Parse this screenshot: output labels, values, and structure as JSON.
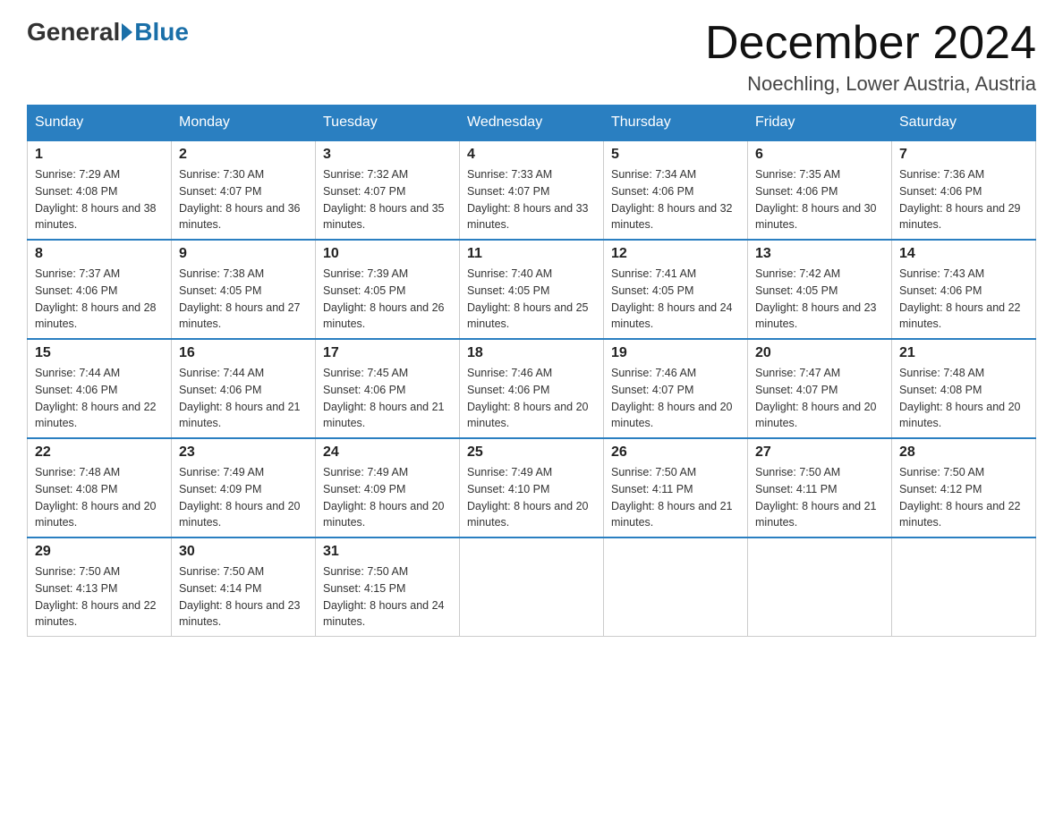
{
  "header": {
    "logo_general": "General",
    "logo_blue": "Blue",
    "month_title": "December 2024",
    "location": "Noechling, Lower Austria, Austria"
  },
  "days_of_week": [
    "Sunday",
    "Monday",
    "Tuesday",
    "Wednesday",
    "Thursday",
    "Friday",
    "Saturday"
  ],
  "weeks": [
    [
      {
        "day": "1",
        "sunrise": "7:29 AM",
        "sunset": "4:08 PM",
        "daylight": "8 hours and 38 minutes."
      },
      {
        "day": "2",
        "sunrise": "7:30 AM",
        "sunset": "4:07 PM",
        "daylight": "8 hours and 36 minutes."
      },
      {
        "day": "3",
        "sunrise": "7:32 AM",
        "sunset": "4:07 PM",
        "daylight": "8 hours and 35 minutes."
      },
      {
        "day": "4",
        "sunrise": "7:33 AM",
        "sunset": "4:07 PM",
        "daylight": "8 hours and 33 minutes."
      },
      {
        "day": "5",
        "sunrise": "7:34 AM",
        "sunset": "4:06 PM",
        "daylight": "8 hours and 32 minutes."
      },
      {
        "day": "6",
        "sunrise": "7:35 AM",
        "sunset": "4:06 PM",
        "daylight": "8 hours and 30 minutes."
      },
      {
        "day": "7",
        "sunrise": "7:36 AM",
        "sunset": "4:06 PM",
        "daylight": "8 hours and 29 minutes."
      }
    ],
    [
      {
        "day": "8",
        "sunrise": "7:37 AM",
        "sunset": "4:06 PM",
        "daylight": "8 hours and 28 minutes."
      },
      {
        "day": "9",
        "sunrise": "7:38 AM",
        "sunset": "4:05 PM",
        "daylight": "8 hours and 27 minutes."
      },
      {
        "day": "10",
        "sunrise": "7:39 AM",
        "sunset": "4:05 PM",
        "daylight": "8 hours and 26 minutes."
      },
      {
        "day": "11",
        "sunrise": "7:40 AM",
        "sunset": "4:05 PM",
        "daylight": "8 hours and 25 minutes."
      },
      {
        "day": "12",
        "sunrise": "7:41 AM",
        "sunset": "4:05 PM",
        "daylight": "8 hours and 24 minutes."
      },
      {
        "day": "13",
        "sunrise": "7:42 AM",
        "sunset": "4:05 PM",
        "daylight": "8 hours and 23 minutes."
      },
      {
        "day": "14",
        "sunrise": "7:43 AM",
        "sunset": "4:06 PM",
        "daylight": "8 hours and 22 minutes."
      }
    ],
    [
      {
        "day": "15",
        "sunrise": "7:44 AM",
        "sunset": "4:06 PM",
        "daylight": "8 hours and 22 minutes."
      },
      {
        "day": "16",
        "sunrise": "7:44 AM",
        "sunset": "4:06 PM",
        "daylight": "8 hours and 21 minutes."
      },
      {
        "day": "17",
        "sunrise": "7:45 AM",
        "sunset": "4:06 PM",
        "daylight": "8 hours and 21 minutes."
      },
      {
        "day": "18",
        "sunrise": "7:46 AM",
        "sunset": "4:06 PM",
        "daylight": "8 hours and 20 minutes."
      },
      {
        "day": "19",
        "sunrise": "7:46 AM",
        "sunset": "4:07 PM",
        "daylight": "8 hours and 20 minutes."
      },
      {
        "day": "20",
        "sunrise": "7:47 AM",
        "sunset": "4:07 PM",
        "daylight": "8 hours and 20 minutes."
      },
      {
        "day": "21",
        "sunrise": "7:48 AM",
        "sunset": "4:08 PM",
        "daylight": "8 hours and 20 minutes."
      }
    ],
    [
      {
        "day": "22",
        "sunrise": "7:48 AM",
        "sunset": "4:08 PM",
        "daylight": "8 hours and 20 minutes."
      },
      {
        "day": "23",
        "sunrise": "7:49 AM",
        "sunset": "4:09 PM",
        "daylight": "8 hours and 20 minutes."
      },
      {
        "day": "24",
        "sunrise": "7:49 AM",
        "sunset": "4:09 PM",
        "daylight": "8 hours and 20 minutes."
      },
      {
        "day": "25",
        "sunrise": "7:49 AM",
        "sunset": "4:10 PM",
        "daylight": "8 hours and 20 minutes."
      },
      {
        "day": "26",
        "sunrise": "7:50 AM",
        "sunset": "4:11 PM",
        "daylight": "8 hours and 21 minutes."
      },
      {
        "day": "27",
        "sunrise": "7:50 AM",
        "sunset": "4:11 PM",
        "daylight": "8 hours and 21 minutes."
      },
      {
        "day": "28",
        "sunrise": "7:50 AM",
        "sunset": "4:12 PM",
        "daylight": "8 hours and 22 minutes."
      }
    ],
    [
      {
        "day": "29",
        "sunrise": "7:50 AM",
        "sunset": "4:13 PM",
        "daylight": "8 hours and 22 minutes."
      },
      {
        "day": "30",
        "sunrise": "7:50 AM",
        "sunset": "4:14 PM",
        "daylight": "8 hours and 23 minutes."
      },
      {
        "day": "31",
        "sunrise": "7:50 AM",
        "sunset": "4:15 PM",
        "daylight": "8 hours and 24 minutes."
      },
      null,
      null,
      null,
      null
    ]
  ]
}
